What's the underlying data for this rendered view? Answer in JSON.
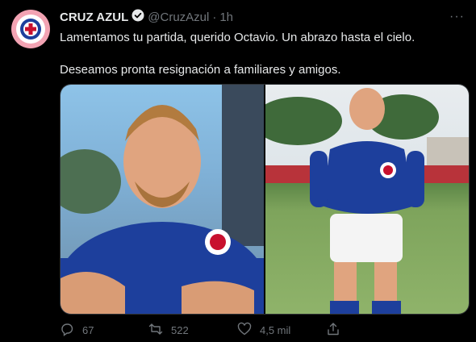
{
  "tweet": {
    "name": "CRUZ AZUL",
    "handle": "@CruzAzul",
    "dot": "·",
    "time": "1h",
    "more": "···",
    "text_1": "Lamentamos tu partida, querido Octavio. Un abrazo hasta el cielo.",
    "text_2": "Deseamos pronta resignación a familiares y amigos."
  },
  "actions": {
    "replies": "67",
    "retweets": "522",
    "likes": "4,5 mil"
  },
  "icons": {
    "verified": "verified-badge-icon",
    "reply": "reply-icon",
    "retweet": "retweet-icon",
    "like": "heart-icon",
    "share": "share-icon"
  },
  "colors": {
    "background": "#000000",
    "text": "#e7e9ea",
    "muted": "#71767b",
    "avatar_bg": "#f2a3b3",
    "club_blue": "#1d3f9c"
  }
}
